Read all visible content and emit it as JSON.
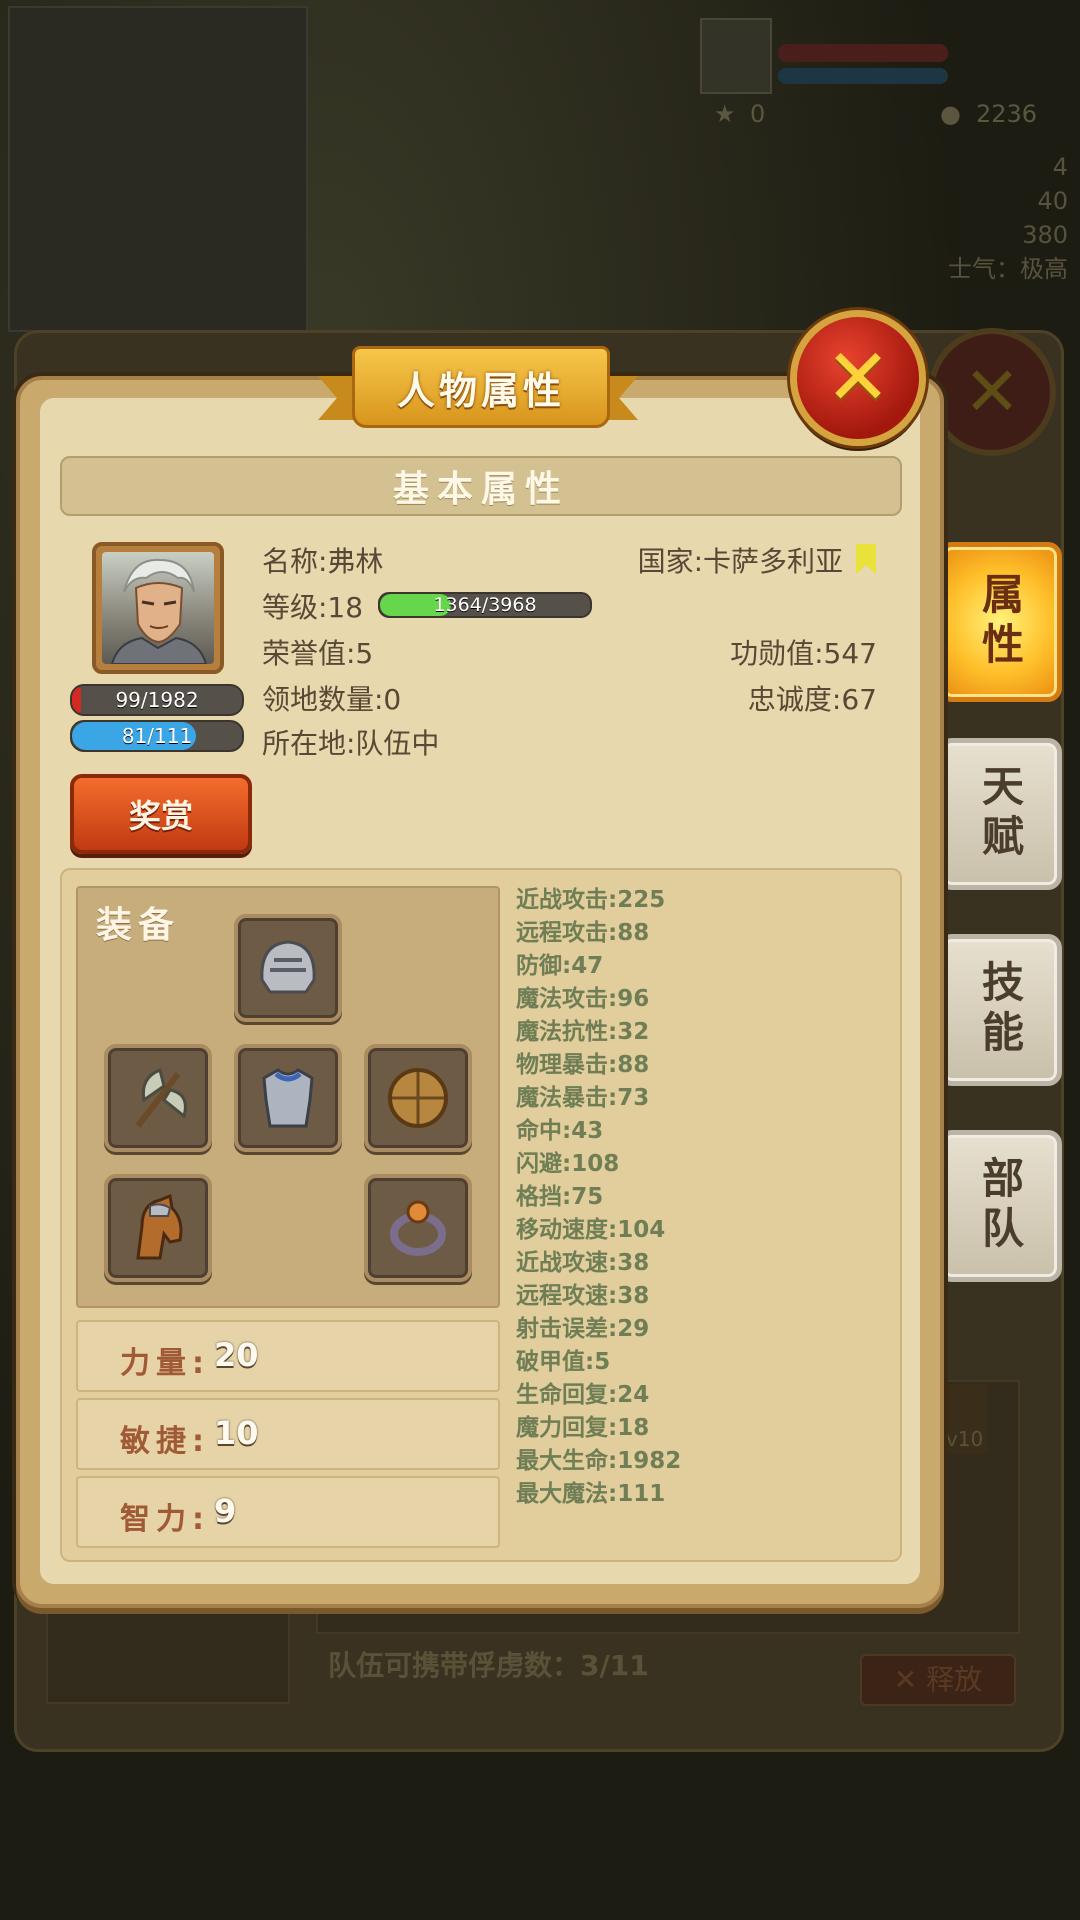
{
  "window": {
    "title": "人物属性",
    "section_title": "基本属性"
  },
  "background": {
    "minimap_labels": [
      "",
      ""
    ],
    "player_resource_star": "0",
    "player_resource_gold": "2236",
    "side_stats": [
      "4",
      "40",
      "380",
      "士气：极高"
    ],
    "prisoner_text": "队伍可携带俘虏数：3/11",
    "release_label": "释放",
    "level_badge": "Lv10"
  },
  "character": {
    "name": "名称:弗林",
    "level": "等级:18",
    "exp_text": "1364/3968",
    "exp_ratio": 0.34,
    "honor": "荣誉值:5",
    "territory": "领地数量:0",
    "location": "所在地:队伍中",
    "country": "国家:卡萨多利亚",
    "merit": "功勋值:547",
    "loyalty": "忠诚度:67",
    "hp_text": "99/1982",
    "hp_ratio": 0.05,
    "mp_text": "81/111",
    "mp_ratio": 0.73,
    "reward_label": "奖赏"
  },
  "equipment": {
    "title": "装备",
    "slots": [
      "helmet",
      "axe",
      "armor",
      "shield",
      "horse",
      "ring"
    ]
  },
  "attributes": [
    {
      "label": "力量:",
      "value": "20"
    },
    {
      "label": "敏捷:",
      "value": "10"
    },
    {
      "label": "智力:",
      "value": "9"
    }
  ],
  "stats": [
    "近战攻击:225",
    "远程攻击:88",
    "防御:47",
    "魔法攻击:96",
    "魔法抗性:32",
    "物理暴击:88",
    "魔法暴击:73",
    "命中:43",
    "闪避:108",
    "格挡:75",
    "移动速度:104",
    "近战攻速:38",
    "远程攻速:38",
    "射击误差:29",
    "破甲值:5",
    "生命回复:24",
    "魔力回复:18",
    "最大生命:1982",
    "最大魔法:111"
  ],
  "tabs": [
    {
      "label": "属性",
      "active": true
    },
    {
      "label": "天赋",
      "active": false
    },
    {
      "label": "技能",
      "active": false
    },
    {
      "label": "部队",
      "active": false
    }
  ],
  "colors": {
    "hp": "#d42a22",
    "mp": "#3aa6e6",
    "exp": "#66d64a"
  }
}
